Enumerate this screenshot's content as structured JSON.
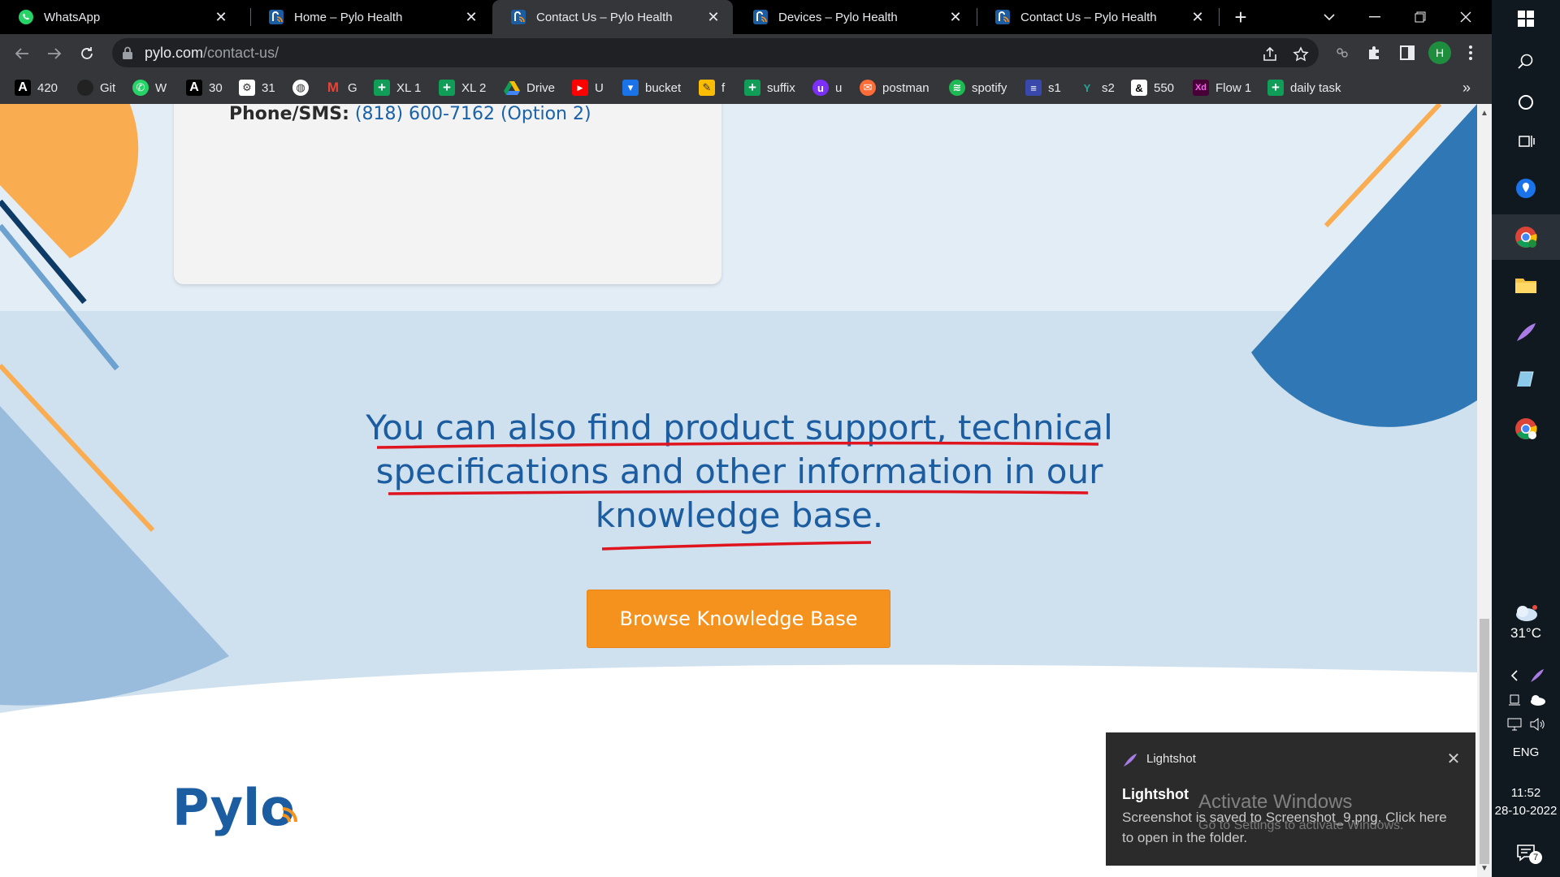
{
  "tabs": [
    {
      "title": "WhatsApp",
      "icon": "whatsapp-icon",
      "active": false
    },
    {
      "title": "Home – Pylo Health",
      "icon": "pylo-favicon",
      "active": false
    },
    {
      "title": "Contact Us – Pylo Health",
      "icon": "pylo-favicon",
      "active": true
    },
    {
      "title": "Devices – Pylo Health",
      "icon": "pylo-favicon",
      "active": false
    },
    {
      "title": "Contact Us – Pylo Health",
      "icon": "pylo-favicon",
      "active": false
    }
  ],
  "address": {
    "host": "pylo.com",
    "path": "/contact-us/"
  },
  "profile_initial": "H",
  "bookmarks": [
    {
      "label": "420",
      "icon": "a-icon"
    },
    {
      "label": "Git",
      "icon": "github-icon"
    },
    {
      "label": "W",
      "icon": "whatsapp-icon"
    },
    {
      "label": "30",
      "icon": "a-icon"
    },
    {
      "label": "31",
      "icon": "gear-icon"
    },
    {
      "label": "",
      "icon": "globe-icon"
    },
    {
      "label": "G",
      "icon": "gmail-icon"
    },
    {
      "label": "XL 1",
      "icon": "sheets-icon"
    },
    {
      "label": "XL 2",
      "icon": "sheets-icon"
    },
    {
      "label": "Drive",
      "icon": "drive-icon"
    },
    {
      "label": "U",
      "icon": "youtube-icon"
    },
    {
      "label": "bucket",
      "icon": "bucket-icon"
    },
    {
      "label": "f",
      "icon": "keep-icon"
    },
    {
      "label": "suffix",
      "icon": "sheets-icon"
    },
    {
      "label": "u",
      "icon": "u-icon"
    },
    {
      "label": "postman",
      "icon": "postman-icon"
    },
    {
      "label": "spotify",
      "icon": "spotify-icon"
    },
    {
      "label": "s1",
      "icon": "s1-icon"
    },
    {
      "label": "s2",
      "icon": "s2-icon"
    },
    {
      "label": "550",
      "icon": "ampersand-icon"
    },
    {
      "label": "Flow 1",
      "icon": "xd-icon"
    },
    {
      "label": "daily task",
      "icon": "sheets-icon"
    }
  ],
  "page": {
    "phone_label": "Phone/SMS:",
    "phone_number": "(818) 600-7162 (Option 2)",
    "kb_line1": "You can also find product support, technical",
    "kb_line2": "specifications and other information in our",
    "kb_line3": "knowledge base.",
    "kb_button": "Browse Knowledge Base",
    "logo_text": "Pylo"
  },
  "notification": {
    "app": "Lightshot",
    "title": "Lightshot",
    "body": "Screenshot is saved to Screenshot_9.png. Click here to open in the folder.",
    "watermark_line1": "Activate Windows",
    "watermark_line2": "Go to Settings to activate Windows."
  },
  "taskbar": {
    "temperature": "31°C",
    "language": "ENG",
    "time": "11:52",
    "date": "28-10-2022",
    "notification_count": "7"
  },
  "colors": {
    "accent_orange": "#f5921e",
    "brand_blue": "#1b5da0",
    "annotation_red": "#e0141e"
  }
}
